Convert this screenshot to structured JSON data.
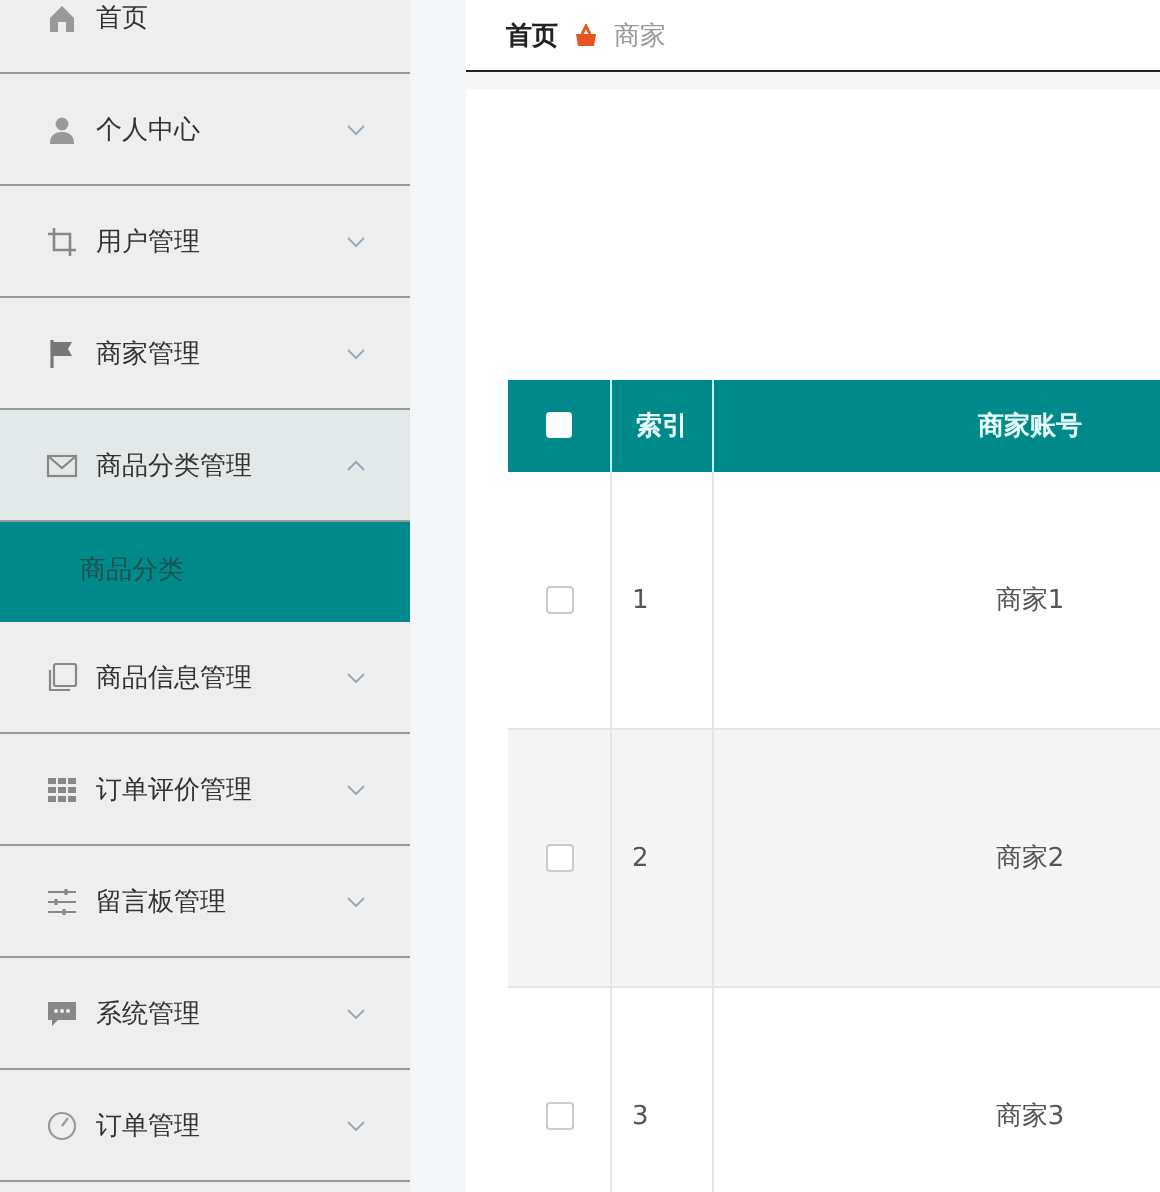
{
  "sidebar": {
    "items": [
      {
        "label": "首页",
        "kind": "link"
      },
      {
        "label": "个人中心",
        "kind": "submenu",
        "expanded": false
      },
      {
        "label": "用户管理",
        "kind": "submenu",
        "expanded": false
      },
      {
        "label": "商家管理",
        "kind": "submenu",
        "expanded": false
      },
      {
        "label": "商品分类管理",
        "kind": "submenu",
        "expanded": true,
        "children": [
          {
            "label": "商品分类",
            "selected": true
          }
        ]
      },
      {
        "label": "商品信息管理",
        "kind": "submenu",
        "expanded": false
      },
      {
        "label": "订单评价管理",
        "kind": "submenu",
        "expanded": false
      },
      {
        "label": "留言板管理",
        "kind": "submenu",
        "expanded": false
      },
      {
        "label": "系统管理",
        "kind": "submenu",
        "expanded": false
      },
      {
        "label": "订单管理",
        "kind": "submenu",
        "expanded": false
      }
    ]
  },
  "breadcrumb": [
    "首页",
    "商家"
  ],
  "table": {
    "header_checkbox": {
      "checked": false
    },
    "columns": [
      "索引",
      "商家账号"
    ],
    "rows": [
      {
        "checked": false,
        "index": "1",
        "account": "商家1"
      },
      {
        "checked": false,
        "index": "2",
        "account": "商家2"
      },
      {
        "checked": false,
        "index": "3",
        "account": "商家3"
      }
    ]
  }
}
